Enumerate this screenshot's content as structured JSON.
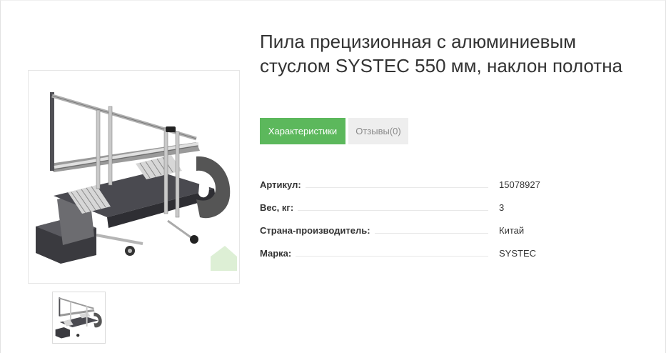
{
  "product": {
    "title": "Пила прецизионная с алюминиевым стуслом SYSTEC 550 мм, наклон полотна",
    "main_image_icon": "miter-saw-image",
    "thumbnail_icon": "miter-saw-thumbnail"
  },
  "tabs": [
    {
      "label": "Характеристики",
      "active": true
    },
    {
      "label": "Отзывы(0)",
      "active": false
    }
  ],
  "specs": [
    {
      "label": "Артикул:",
      "value": "15078927"
    },
    {
      "label": "Вес, кг:",
      "value": "3"
    },
    {
      "label": "Страна-производитель:",
      "value": "Китай"
    },
    {
      "label": "Марка:",
      "value": "SYSTEC"
    }
  ],
  "colors": {
    "accent": "#5cb85c",
    "tab_inactive_bg": "#eeeeee",
    "text": "#333333"
  }
}
